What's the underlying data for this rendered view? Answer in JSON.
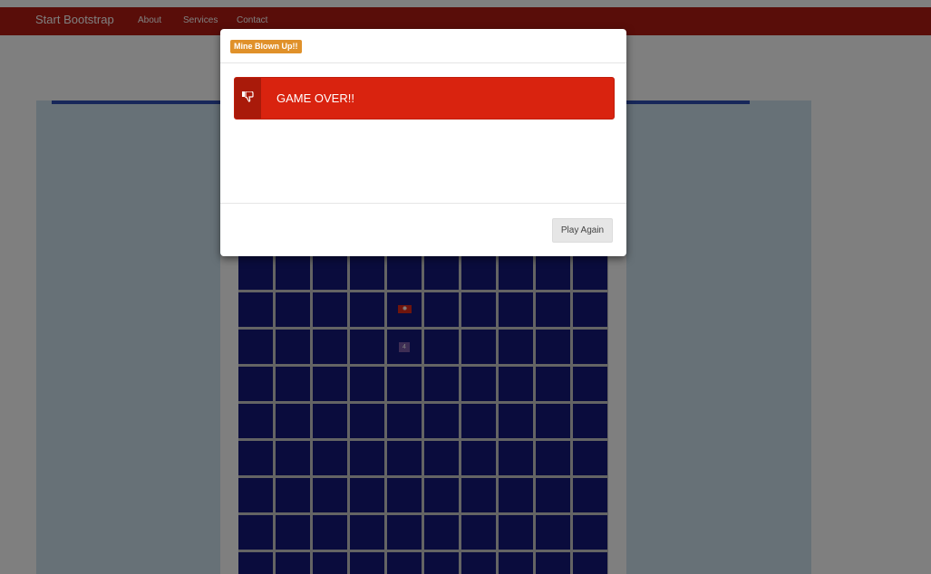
{
  "navbar": {
    "brand": "Start Bootstrap",
    "links": [
      "About",
      "Services",
      "Contact"
    ],
    "color": "#b31b12"
  },
  "board": {
    "columns": 10,
    "visible_rows": 9,
    "cell_color": "#15187a",
    "revealed": [
      {
        "row": 1,
        "col": 4,
        "type": "mine",
        "icon": "mine-icon",
        "color": "#e02a1a"
      },
      {
        "row": 2,
        "col": 4,
        "type": "number",
        "value": "4",
        "color": "#7b5aa8"
      }
    ]
  },
  "modal": {
    "badge": "Mine Blown Up!!",
    "badge_color": "#e0912a",
    "alert_text": "GAME OVER!!",
    "alert_icon": "thumbs-down-icon",
    "alert_color": "#d9230f",
    "play_again_label": "Play Again"
  }
}
